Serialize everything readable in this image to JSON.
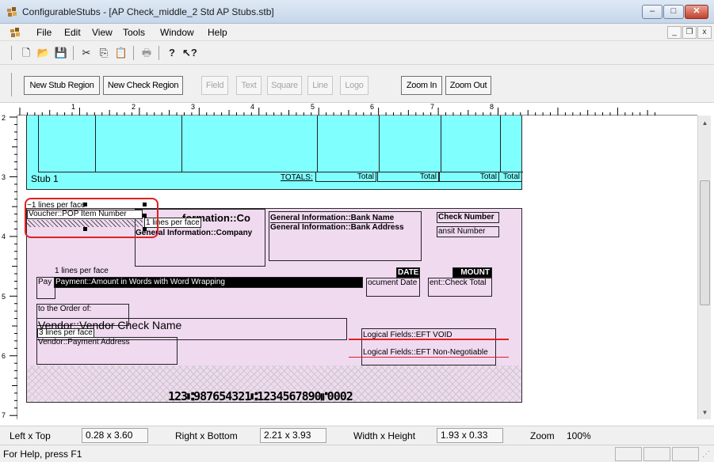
{
  "window": {
    "title": "ConfigurableStubs - [AP Check_middle_2 Std AP Stubs.stb]",
    "minimize_glyph": "‒",
    "maximize_glyph": "□",
    "close_glyph": "✕"
  },
  "menu": {
    "items": [
      "File",
      "Edit",
      "View",
      "Tools",
      "Window",
      "Help"
    ],
    "mdi_min": "_",
    "mdi_restore": "❐",
    "mdi_close": "x"
  },
  "std_toolbar": {
    "icons": [
      "new-file-icon",
      "open-folder-icon",
      "save-icon",
      "cut-icon",
      "copy-icon",
      "paste-icon",
      "print-icon",
      "about-icon",
      "context-help-icon"
    ],
    "glyphs": [
      "🗋",
      "📂",
      "💾",
      "✂",
      "⎘",
      "📋",
      "🖶",
      "?",
      "↖?"
    ]
  },
  "region_toolbar": {
    "new_stub_region": "New Stub Region",
    "new_check_region": "New Check Region",
    "field": "Field",
    "text": "Text",
    "square": "Square",
    "line": "Line",
    "logo": "Logo",
    "zoom_in": "Zoom In",
    "zoom_out": "Zoom Out"
  },
  "ruler": {
    "top_numbers": [
      "1",
      "2",
      "3",
      "4",
      "5",
      "6",
      "7",
      "8"
    ],
    "left_numbers": [
      "2",
      "3",
      "4",
      "5",
      "6",
      "7"
    ]
  },
  "stub": {
    "label": "Stub 1",
    "totals_label": "TOTALS:",
    "total_fields": [
      "Total",
      "Total",
      "Total",
      "Total"
    ]
  },
  "check": {
    "selected_field": {
      "lines_per_face": "~1 lines per face",
      "name": "Voucher::POP Item Number"
    },
    "company_lines": "1 lines per face",
    "company_name_header": "General Information::Company Name",
    "company_name_header_visible": "formation::Co",
    "company_field": "General Information::Company",
    "bank_name": "General Information::Bank Name",
    "bank_address": "General Information::Bank Address",
    "check_number": "Check Number",
    "transit_number": "ansit Number",
    "amount_words_lines": "1 lines per face",
    "pay_label": "Pay",
    "amount_words_field": "Payment::Amount in Words with Word Wrapping",
    "date_header": "DATE",
    "amount_header": "MOUNT",
    "document_date": "ocument Date",
    "check_total": "ent::Check Total",
    "order_of_label": "to the Order of:",
    "vendor_check_name": "Vendor::Vendor Check Name",
    "address_lines": "3 lines per face",
    "vendor_address": "Vendor::Payment Address",
    "eft_void": "Logical Fields::EFT VOID",
    "eft_non_negotiable": "Logical Fields::EFT Non-Negotiable",
    "micr_line": "123⑆987654321⑆1234567890⑈0002"
  },
  "info_bar": {
    "left_top_label": "Left x Top",
    "left_top_value": "0.28 x 3.60",
    "right_bottom_label": "Right x Bottom",
    "right_bottom_value": "2.21 x 3.93",
    "width_height_label": "Width x Height",
    "width_height_value": "1.93 x 0.33",
    "zoom_label": "Zoom",
    "zoom_value": "100%"
  },
  "status": {
    "help_text": "For Help, press F1"
  },
  "colors": {
    "stub_region": "#80ffff",
    "check_region": "#f0daf0",
    "highlight_red": "#e02020"
  }
}
